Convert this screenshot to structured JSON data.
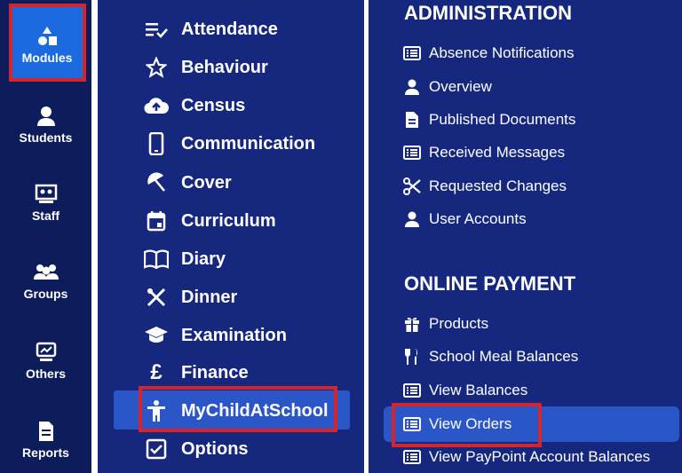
{
  "colors": {
    "rail_bg": "#0d1c5b",
    "panel_bg": "#15287d",
    "active_bg": "#1b6ae0",
    "highlight_bg": "#2a56c8",
    "callout_border": "#d4252d",
    "text": "#ffffff"
  },
  "rail": {
    "items": [
      {
        "label": "Modules",
        "icon": "modules-icon",
        "active": true
      },
      {
        "label": "Students",
        "icon": "student-icon"
      },
      {
        "label": "Staff",
        "icon": "staff-icon"
      },
      {
        "label": "Groups",
        "icon": "groups-icon"
      },
      {
        "label": "Others",
        "icon": "others-icon"
      },
      {
        "label": "Reports",
        "icon": "report-icon"
      }
    ]
  },
  "modules": {
    "items": [
      {
        "label": "Attendance",
        "icon": "attendance-icon"
      },
      {
        "label": "Behaviour",
        "icon": "star-icon"
      },
      {
        "label": "Census",
        "icon": "cloud-upload-icon"
      },
      {
        "label": "Communication",
        "icon": "phone-icon"
      },
      {
        "label": "Cover",
        "icon": "umbrella-icon"
      },
      {
        "label": "Curriculum",
        "icon": "calendar-icon"
      },
      {
        "label": "Diary",
        "icon": "book-icon"
      },
      {
        "label": "Dinner",
        "icon": "utensils-icon"
      },
      {
        "label": "Examination",
        "icon": "graduation-cap-icon"
      },
      {
        "label": "Finance",
        "icon": "pound-icon"
      },
      {
        "label": "MyChildAtSchool",
        "icon": "child-icon",
        "selected": true
      },
      {
        "label": "Options",
        "icon": "checkbox-icon"
      }
    ]
  },
  "submenu": {
    "sections": [
      {
        "title": "ADMINISTRATION",
        "items": [
          {
            "label": "Absence Notifications",
            "icon": "list-icon"
          },
          {
            "label": "Overview",
            "icon": "user-icon"
          },
          {
            "label": "Published Documents",
            "icon": "document-icon"
          },
          {
            "label": "Received Messages",
            "icon": "list-icon"
          },
          {
            "label": "Requested Changes",
            "icon": "scissors-icon"
          },
          {
            "label": "User Accounts",
            "icon": "user-icon"
          }
        ]
      },
      {
        "title": "ONLINE PAYMENT",
        "items": [
          {
            "label": "Products",
            "icon": "gift-icon"
          },
          {
            "label": "School Meal Balances",
            "icon": "cutlery-icon"
          },
          {
            "label": "View Balances",
            "icon": "list-icon"
          },
          {
            "label": "View Orders",
            "icon": "list-icon",
            "selected": true
          },
          {
            "label": "View PayPoint Account Balances",
            "icon": "list-icon"
          }
        ]
      }
    ]
  }
}
